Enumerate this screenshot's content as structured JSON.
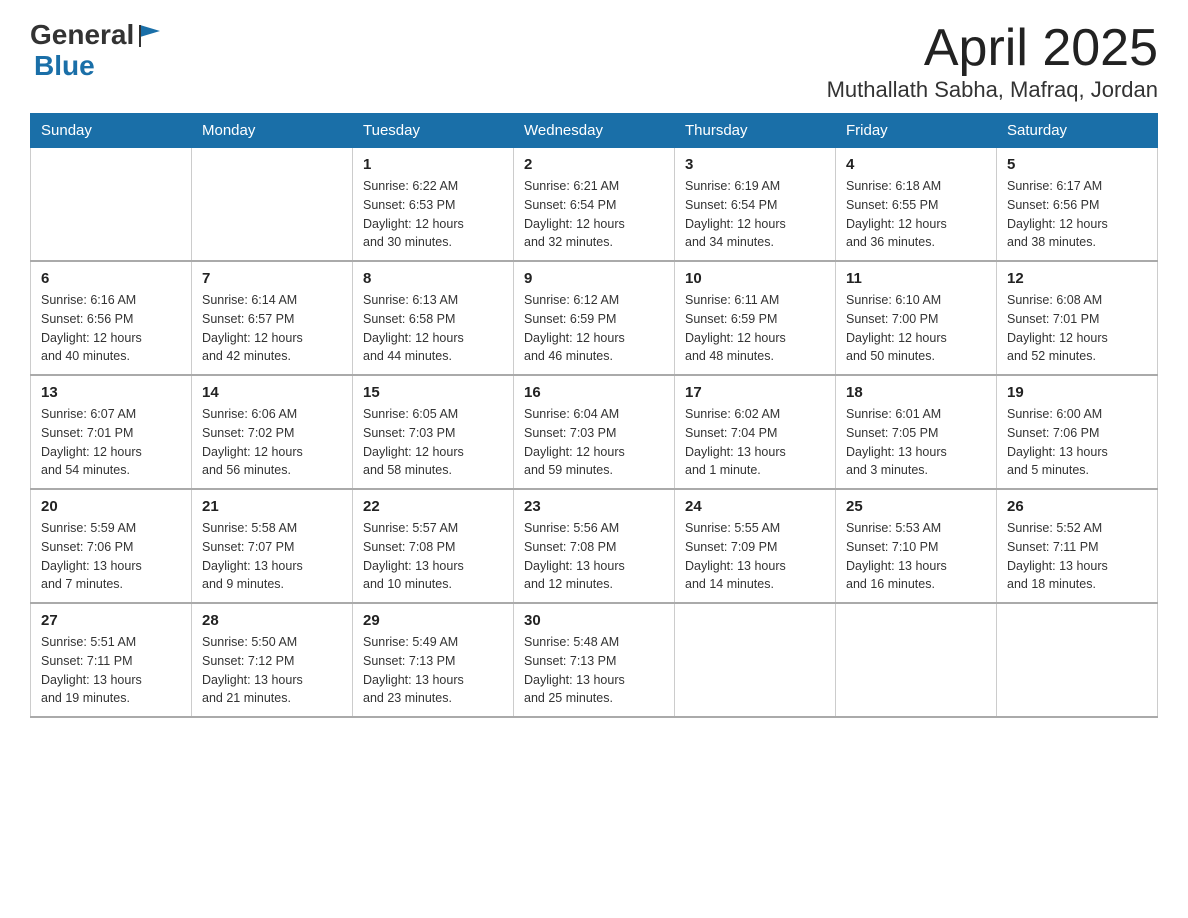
{
  "header": {
    "logo_general": "General",
    "logo_blue": "Blue",
    "month_year": "April 2025",
    "location": "Muthallath Sabha, Mafraq, Jordan"
  },
  "weekdays": [
    "Sunday",
    "Monday",
    "Tuesday",
    "Wednesday",
    "Thursday",
    "Friday",
    "Saturday"
  ],
  "weeks": [
    [
      {
        "day": "",
        "info": ""
      },
      {
        "day": "",
        "info": ""
      },
      {
        "day": "1",
        "info": "Sunrise: 6:22 AM\nSunset: 6:53 PM\nDaylight: 12 hours\nand 30 minutes."
      },
      {
        "day": "2",
        "info": "Sunrise: 6:21 AM\nSunset: 6:54 PM\nDaylight: 12 hours\nand 32 minutes."
      },
      {
        "day": "3",
        "info": "Sunrise: 6:19 AM\nSunset: 6:54 PM\nDaylight: 12 hours\nand 34 minutes."
      },
      {
        "day": "4",
        "info": "Sunrise: 6:18 AM\nSunset: 6:55 PM\nDaylight: 12 hours\nand 36 minutes."
      },
      {
        "day": "5",
        "info": "Sunrise: 6:17 AM\nSunset: 6:56 PM\nDaylight: 12 hours\nand 38 minutes."
      }
    ],
    [
      {
        "day": "6",
        "info": "Sunrise: 6:16 AM\nSunset: 6:56 PM\nDaylight: 12 hours\nand 40 minutes."
      },
      {
        "day": "7",
        "info": "Sunrise: 6:14 AM\nSunset: 6:57 PM\nDaylight: 12 hours\nand 42 minutes."
      },
      {
        "day": "8",
        "info": "Sunrise: 6:13 AM\nSunset: 6:58 PM\nDaylight: 12 hours\nand 44 minutes."
      },
      {
        "day": "9",
        "info": "Sunrise: 6:12 AM\nSunset: 6:59 PM\nDaylight: 12 hours\nand 46 minutes."
      },
      {
        "day": "10",
        "info": "Sunrise: 6:11 AM\nSunset: 6:59 PM\nDaylight: 12 hours\nand 48 minutes."
      },
      {
        "day": "11",
        "info": "Sunrise: 6:10 AM\nSunset: 7:00 PM\nDaylight: 12 hours\nand 50 minutes."
      },
      {
        "day": "12",
        "info": "Sunrise: 6:08 AM\nSunset: 7:01 PM\nDaylight: 12 hours\nand 52 minutes."
      }
    ],
    [
      {
        "day": "13",
        "info": "Sunrise: 6:07 AM\nSunset: 7:01 PM\nDaylight: 12 hours\nand 54 minutes."
      },
      {
        "day": "14",
        "info": "Sunrise: 6:06 AM\nSunset: 7:02 PM\nDaylight: 12 hours\nand 56 minutes."
      },
      {
        "day": "15",
        "info": "Sunrise: 6:05 AM\nSunset: 7:03 PM\nDaylight: 12 hours\nand 58 minutes."
      },
      {
        "day": "16",
        "info": "Sunrise: 6:04 AM\nSunset: 7:03 PM\nDaylight: 12 hours\nand 59 minutes."
      },
      {
        "day": "17",
        "info": "Sunrise: 6:02 AM\nSunset: 7:04 PM\nDaylight: 13 hours\nand 1 minute."
      },
      {
        "day": "18",
        "info": "Sunrise: 6:01 AM\nSunset: 7:05 PM\nDaylight: 13 hours\nand 3 minutes."
      },
      {
        "day": "19",
        "info": "Sunrise: 6:00 AM\nSunset: 7:06 PM\nDaylight: 13 hours\nand 5 minutes."
      }
    ],
    [
      {
        "day": "20",
        "info": "Sunrise: 5:59 AM\nSunset: 7:06 PM\nDaylight: 13 hours\nand 7 minutes."
      },
      {
        "day": "21",
        "info": "Sunrise: 5:58 AM\nSunset: 7:07 PM\nDaylight: 13 hours\nand 9 minutes."
      },
      {
        "day": "22",
        "info": "Sunrise: 5:57 AM\nSunset: 7:08 PM\nDaylight: 13 hours\nand 10 minutes."
      },
      {
        "day": "23",
        "info": "Sunrise: 5:56 AM\nSunset: 7:08 PM\nDaylight: 13 hours\nand 12 minutes."
      },
      {
        "day": "24",
        "info": "Sunrise: 5:55 AM\nSunset: 7:09 PM\nDaylight: 13 hours\nand 14 minutes."
      },
      {
        "day": "25",
        "info": "Sunrise: 5:53 AM\nSunset: 7:10 PM\nDaylight: 13 hours\nand 16 minutes."
      },
      {
        "day": "26",
        "info": "Sunrise: 5:52 AM\nSunset: 7:11 PM\nDaylight: 13 hours\nand 18 minutes."
      }
    ],
    [
      {
        "day": "27",
        "info": "Sunrise: 5:51 AM\nSunset: 7:11 PM\nDaylight: 13 hours\nand 19 minutes."
      },
      {
        "day": "28",
        "info": "Sunrise: 5:50 AM\nSunset: 7:12 PM\nDaylight: 13 hours\nand 21 minutes."
      },
      {
        "day": "29",
        "info": "Sunrise: 5:49 AM\nSunset: 7:13 PM\nDaylight: 13 hours\nand 23 minutes."
      },
      {
        "day": "30",
        "info": "Sunrise: 5:48 AM\nSunset: 7:13 PM\nDaylight: 13 hours\nand 25 minutes."
      },
      {
        "day": "",
        "info": ""
      },
      {
        "day": "",
        "info": ""
      },
      {
        "day": "",
        "info": ""
      }
    ]
  ]
}
